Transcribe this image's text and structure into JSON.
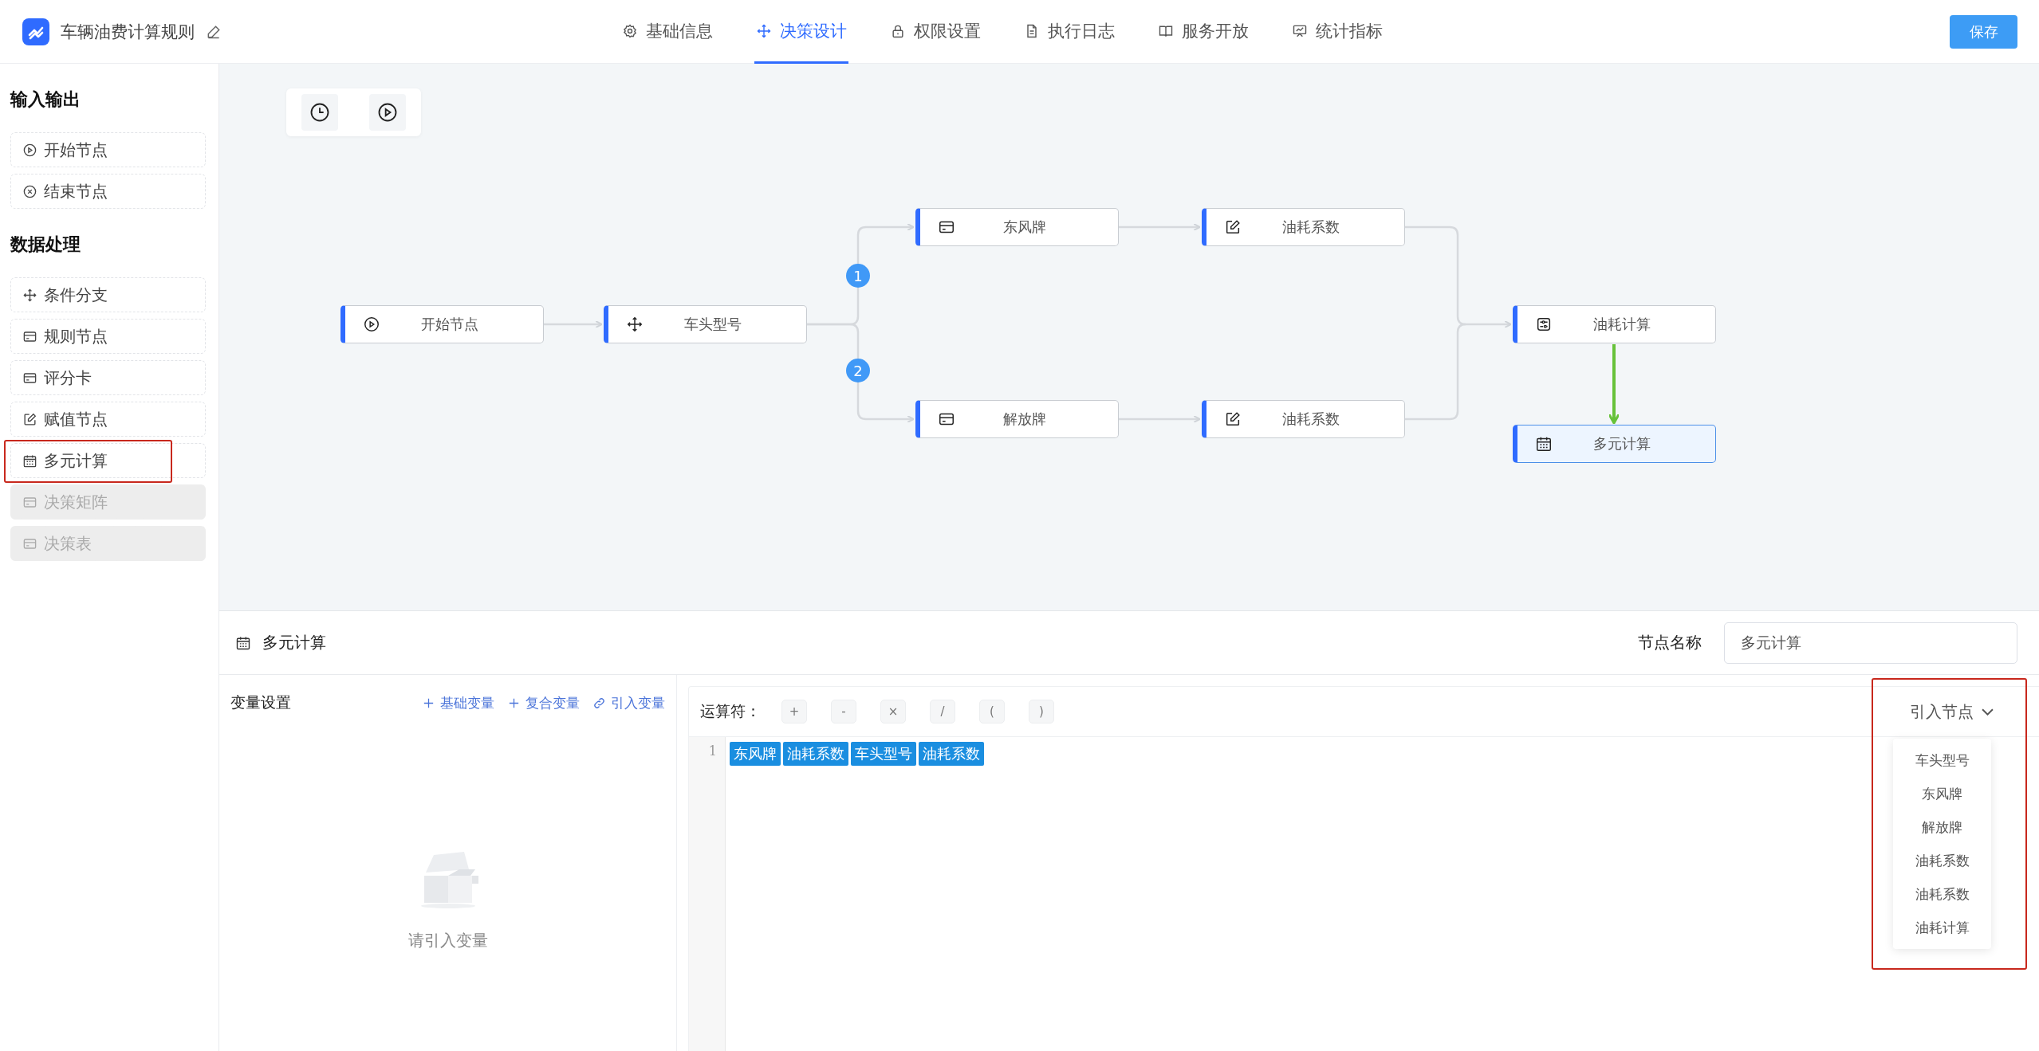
{
  "app": {
    "title": "车辆油费计算规则"
  },
  "tabs": [
    {
      "label": "基础信息",
      "selected": false
    },
    {
      "label": "决策设计",
      "selected": true
    },
    {
      "label": "权限设置",
      "selected": false
    },
    {
      "label": "执行日志",
      "selected": false
    },
    {
      "label": "服务开放",
      "selected": false
    },
    {
      "label": "统计指标",
      "selected": false
    }
  ],
  "save_button": "保存",
  "sidebar": {
    "sections": [
      {
        "title": "输入输出",
        "items": [
          {
            "label": "开始节点",
            "kind": "start",
            "disabled": false,
            "highlighted": false
          },
          {
            "label": "结束节点",
            "kind": "end",
            "disabled": false,
            "highlighted": false
          }
        ]
      },
      {
        "title": "数据处理",
        "items": [
          {
            "label": "条件分支",
            "kind": "branch",
            "disabled": false,
            "highlighted": false
          },
          {
            "label": "规则节点",
            "kind": "rule",
            "disabled": false,
            "highlighted": false
          },
          {
            "label": "评分卡",
            "kind": "rule",
            "disabled": false,
            "highlighted": false
          },
          {
            "label": "赋值节点",
            "kind": "assign",
            "disabled": false,
            "highlighted": false
          },
          {
            "label": "多元计算",
            "kind": "multi",
            "disabled": false,
            "highlighted": true
          },
          {
            "label": "决策矩阵",
            "kind": "rule",
            "disabled": true,
            "highlighted": false
          },
          {
            "label": "决策表",
            "kind": "rule",
            "disabled": true,
            "highlighted": false
          }
        ]
      }
    ]
  },
  "canvas": {
    "nodes": [
      {
        "label": "开始节点",
        "kind": "start",
        "selected": false
      },
      {
        "label": "车头型号",
        "kind": "branch",
        "selected": false
      },
      {
        "label": "东风牌",
        "kind": "rule",
        "selected": false
      },
      {
        "label": "油耗系数",
        "kind": "assign",
        "selected": false
      },
      {
        "label": "解放牌",
        "kind": "rule",
        "selected": false
      },
      {
        "label": "油耗系数",
        "kind": "assign",
        "selected": false
      },
      {
        "label": "油耗计算",
        "kind": "formula",
        "selected": false
      },
      {
        "label": "多元计算",
        "kind": "multi",
        "selected": true
      }
    ],
    "branch_badges": [
      "1",
      "2"
    ]
  },
  "panel": {
    "title": "多元计算",
    "node_name_label": "节点名称",
    "node_name_value": "多元计算",
    "variables": {
      "title": "变量设置",
      "actions": [
        {
          "label": "基础变量",
          "kind": "add"
        },
        {
          "label": "复合变量",
          "kind": "add"
        },
        {
          "label": "引入变量",
          "kind": "link"
        }
      ],
      "empty_text": "请引入变量"
    },
    "editor": {
      "operator_label": "运算符：",
      "operators": [
        "+",
        "-",
        "×",
        "/",
        "(",
        ")"
      ],
      "line_numbers": [
        "1"
      ],
      "tokens": [
        "东风牌",
        "油耗系数",
        "车头型号",
        "油耗系数"
      ],
      "insert_node": {
        "label": "引入节点",
        "expanded": true,
        "highlighted": true,
        "options": [
          "车头型号",
          "东风牌",
          "解放牌",
          "油耗系数",
          "油耗系数",
          "油耗计算"
        ]
      }
    }
  }
}
